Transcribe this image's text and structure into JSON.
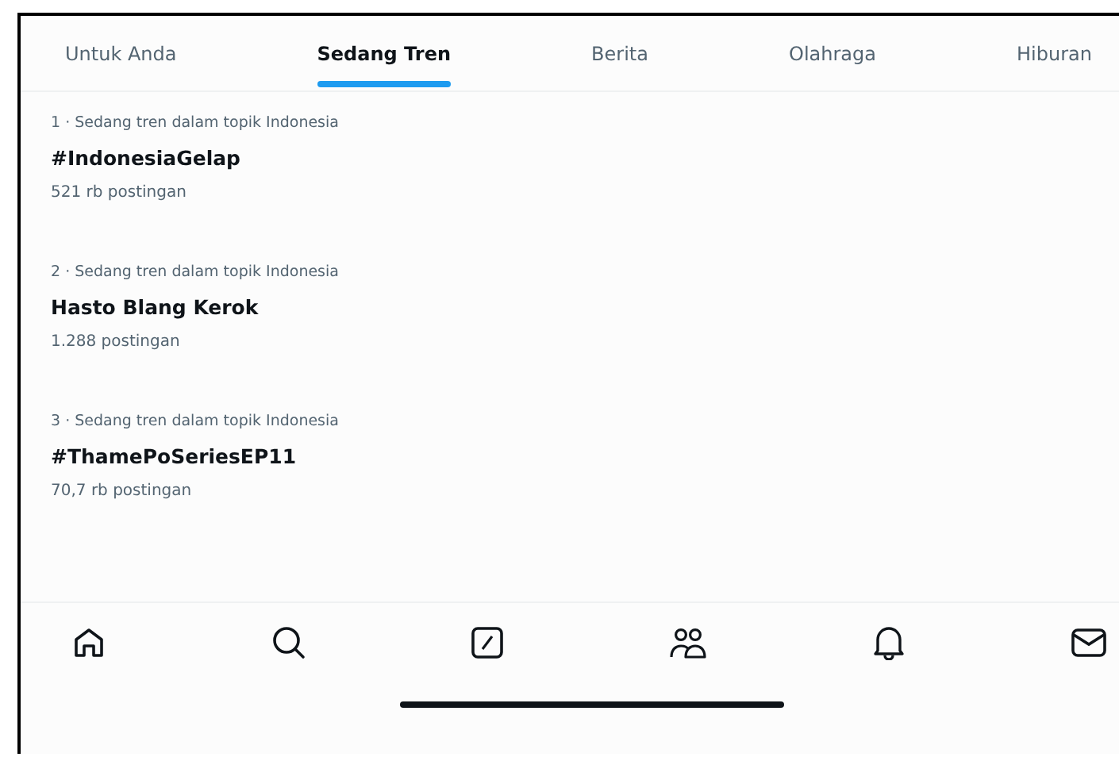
{
  "tabs": [
    {
      "label": "Untuk Anda",
      "selected": false
    },
    {
      "label": "Sedang Tren",
      "selected": true
    },
    {
      "label": "Berita",
      "selected": false
    },
    {
      "label": "Olahraga",
      "selected": false
    },
    {
      "label": "Hiburan",
      "selected": false
    }
  ],
  "trends": [
    {
      "context": "1 · Sedang tren dalam topik Indonesia",
      "title": "#IndonesiaGelap",
      "count": "521 rb postingan"
    },
    {
      "context": "2 · Sedang tren dalam topik Indonesia",
      "title": "Hasto Blang Kerok",
      "count": "1.288 postingan"
    },
    {
      "context": "3 · Sedang tren dalam topik Indonesia",
      "title": "#ThamePoSeriesEP11",
      "count": "70,7 rb postingan"
    }
  ]
}
